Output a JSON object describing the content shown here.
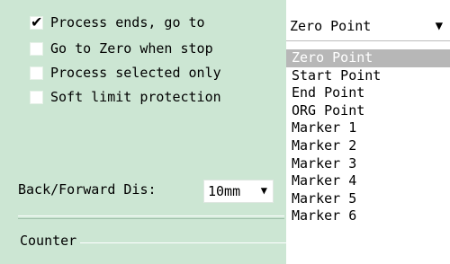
{
  "options": [
    {
      "label": "Process ends, go to",
      "checked": true
    },
    {
      "label": "Go to Zero when stop",
      "checked": false
    },
    {
      "label": "Process selected only",
      "checked": false
    },
    {
      "label": "Soft limit protection",
      "checked": false
    }
  ],
  "check_mark": "✔",
  "back_forward": {
    "label": "Back/Forward Dis:",
    "value": "10mm",
    "arrow": "▼"
  },
  "counter": {
    "label": "Counter"
  },
  "target_dropdown": {
    "value": "Zero Point",
    "arrow": "▼",
    "items": [
      "Zero Point",
      "Start Point",
      "End Point",
      "ORG Point",
      "Marker 1",
      "Marker 2",
      "Marker 3",
      "Marker 4",
      "Marker 5",
      "Marker 6"
    ],
    "selected_index": 0
  }
}
